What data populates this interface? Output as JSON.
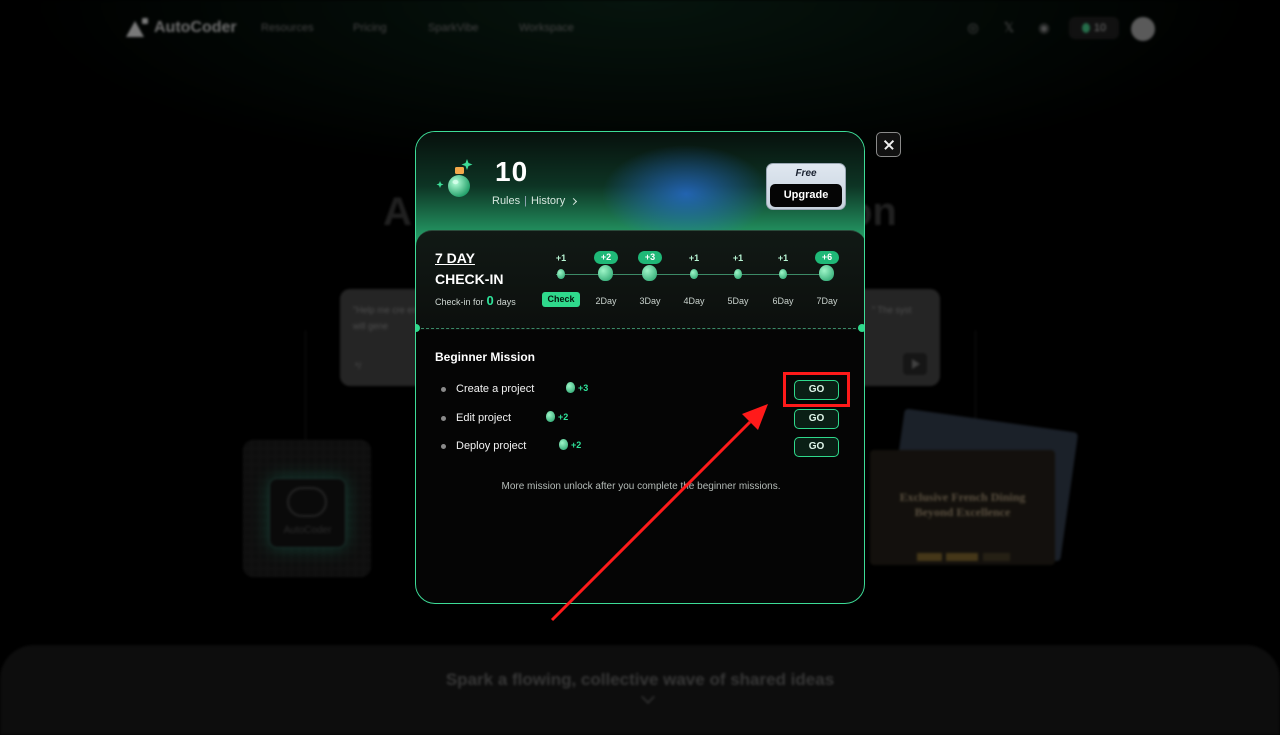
{
  "navbar": {
    "logo_text": "AutoCoder",
    "links": [
      "Resources",
      "Pricing",
      "SparkVibe",
      "Workspace"
    ],
    "icons": [
      "instagram-icon",
      "x-icon",
      "discord-icon"
    ],
    "icon_glyphs": [
      "◎",
      "𝕏",
      "◉"
    ],
    "points": "10"
  },
  "background": {
    "hero_left": "A",
    "hero_right": "on",
    "prompt_left": "\"Help me cre em will gene",
    "prompt_right": "\" The syst",
    "prompt_bottom": "*/",
    "brain_label": "AutoCoder",
    "dining_title": "Exclusive French Dining Beyond Excellence",
    "bottom_text": "Spark a flowing, collective wave of shared ideas"
  },
  "modal": {
    "points": "10",
    "rules_label": "Rules",
    "history_label": "History",
    "plan_label": "Free",
    "upgrade_label": "Upgrade",
    "checkin": {
      "title_line1": "7 DAY",
      "title_line2": "CHECK-IN",
      "sub_prefix": "Check-in for",
      "days_count": "0",
      "sub_suffix": "days",
      "days": [
        {
          "bonus": "+1",
          "label": "Check",
          "big": false,
          "pill": false,
          "is_button": true
        },
        {
          "bonus": "+2",
          "label": "2Day",
          "big": true,
          "pill": true,
          "is_button": false
        },
        {
          "bonus": "+3",
          "label": "3Day",
          "big": true,
          "pill": true,
          "is_button": false
        },
        {
          "bonus": "+1",
          "label": "4Day",
          "big": false,
          "pill": false,
          "is_button": false
        },
        {
          "bonus": "+1",
          "label": "5Day",
          "big": false,
          "pill": false,
          "is_button": false
        },
        {
          "bonus": "+1",
          "label": "6Day",
          "big": false,
          "pill": false,
          "is_button": false
        },
        {
          "bonus": "+6",
          "label": "7Day",
          "big": true,
          "pill": true,
          "is_button": false
        }
      ]
    },
    "missions": {
      "title": "Beginner Mission",
      "items": [
        {
          "name": "Create a project",
          "reward": "+3",
          "button": "GO"
        },
        {
          "name": "Edit project",
          "reward": "+2",
          "button": "GO"
        },
        {
          "name": "Deploy project",
          "reward": "+2",
          "button": "GO"
        }
      ],
      "note": "More mission unlock after you complete the beginner missions."
    }
  },
  "colors": {
    "accent": "#2fd98c",
    "modal_border": "#3ddc97",
    "annotation": "#ff1a1a"
  }
}
